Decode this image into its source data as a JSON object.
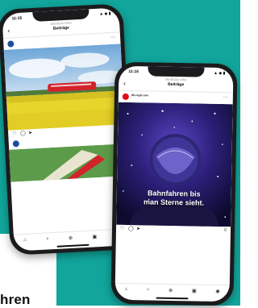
{
  "caption_fragment": "hren",
  "phone_left": {
    "status_time": "11:15",
    "status_signal": "▲ ◆ ▮",
    "nav_back": "‹",
    "nav_sub": "DB REGIO NRW",
    "nav_title": "Beiträge",
    "post1_account": "",
    "post1_location": "",
    "more_icon": "⋯",
    "post1_caption": [
      "",
      ""
    ],
    "post2_account": ""
  },
  "phone_right": {
    "status_time": "11:15",
    "status_signal": "▲ ◆ ▮",
    "nav_back": "‹",
    "nav_sub": "DB REGIO NRW",
    "nav_title": "Beiträge",
    "post_account": "db.regio.nrw",
    "post_location": "",
    "more_icon": "⋯",
    "headline_line1": "Bahnfahren bis",
    "headline_line2": "man Sterne sieht.",
    "likes": "",
    "caption": [
      "",
      ""
    ]
  },
  "icons": {
    "heart": "♡",
    "comment": "◯",
    "share": "➤",
    "bookmark": "⌑",
    "tab_home": "⌂",
    "tab_search": "⌕",
    "tab_add": "⊕",
    "tab_shop": "▣",
    "tab_profile": "◉"
  },
  "colors": {
    "background": "#11a59b",
    "db_red": "#e30613",
    "train_red": "#d2232a",
    "field_yellow": "#e8d52b"
  }
}
